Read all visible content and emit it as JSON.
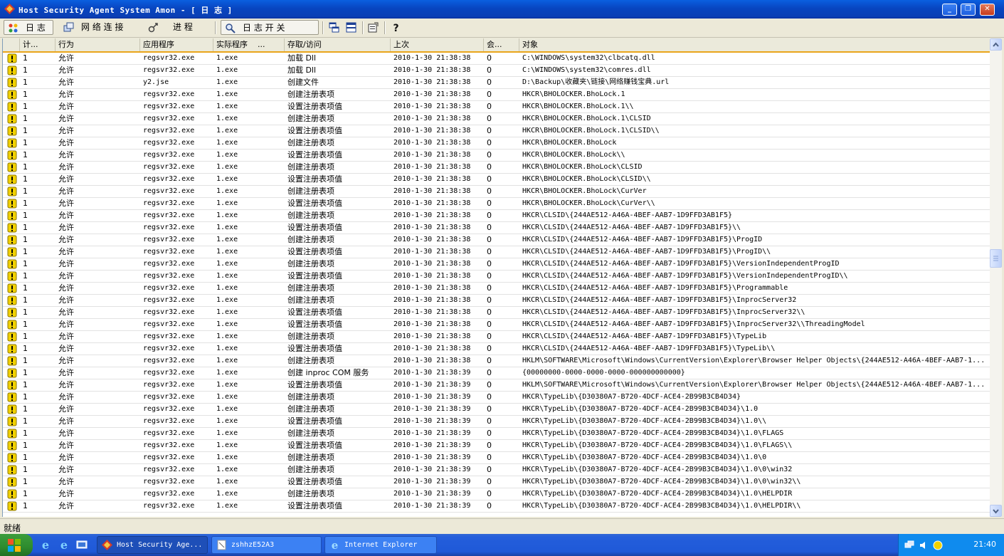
{
  "window": {
    "title": "Host Security Agent System Amon - [ 日 志 ]",
    "controls": {
      "minimize_icon": "minimize-icon",
      "maximize_icon": "restore-icon",
      "close_icon": "close-icon"
    }
  },
  "toolbar": {
    "log_label": "日 志",
    "network_label": "网 络 连 接",
    "process_label": "进 程",
    "log_switch_label": "日 志 开 关",
    "view1_icon": "tile-windows-icon",
    "view2_icon": "split-view-icon",
    "properties_icon": "properties-icon",
    "help_icon": "help-icon"
  },
  "columns": [
    "计...",
    "行为",
    "应用程序",
    "实际程序    ...",
    "存取/访问",
    "上次",
    "会...",
    "对象"
  ],
  "rows": [
    [
      "1",
      "允许",
      "regsvr32.exe",
      "1.exe",
      "加载 Dll",
      "2010-1-30 21:38:38",
      "0",
      "C:\\WINDOWS\\system32\\clbcatq.dll"
    ],
    [
      "1",
      "允许",
      "regsvr32.exe",
      "1.exe",
      "加载 Dll",
      "2010-1-30 21:38:38",
      "0",
      "C:\\WINDOWS\\system32\\comres.dll"
    ],
    [
      "1",
      "允许",
      "y2.jse",
      "1.exe",
      "创建文件",
      "2010-1-30 21:38:38",
      "0",
      "D:\\Backup\\收藏夹\\链接\\网络赚钱宝典.url"
    ],
    [
      "1",
      "允许",
      "regsvr32.exe",
      "1.exe",
      "创建注册表项",
      "2010-1-30 21:38:38",
      "0",
      "HKCR\\BHOLOCKER.BhoLock.1"
    ],
    [
      "1",
      "允许",
      "regsvr32.exe",
      "1.exe",
      "设置注册表项值",
      "2010-1-30 21:38:38",
      "0",
      "HKCR\\BHOLOCKER.BhoLock.1\\\\"
    ],
    [
      "1",
      "允许",
      "regsvr32.exe",
      "1.exe",
      "创建注册表项",
      "2010-1-30 21:38:38",
      "0",
      "HKCR\\BHOLOCKER.BhoLock.1\\CLSID"
    ],
    [
      "1",
      "允许",
      "regsvr32.exe",
      "1.exe",
      "设置注册表项值",
      "2010-1-30 21:38:38",
      "0",
      "HKCR\\BHOLOCKER.BhoLock.1\\CLSID\\\\"
    ],
    [
      "1",
      "允许",
      "regsvr32.exe",
      "1.exe",
      "创建注册表项",
      "2010-1-30 21:38:38",
      "0",
      "HKCR\\BHOLOCKER.BhoLock"
    ],
    [
      "1",
      "允许",
      "regsvr32.exe",
      "1.exe",
      "设置注册表项值",
      "2010-1-30 21:38:38",
      "0",
      "HKCR\\BHOLOCKER.BhoLock\\\\"
    ],
    [
      "1",
      "允许",
      "regsvr32.exe",
      "1.exe",
      "创建注册表项",
      "2010-1-30 21:38:38",
      "0",
      "HKCR\\BHOLOCKER.BhoLock\\CLSID"
    ],
    [
      "1",
      "允许",
      "regsvr32.exe",
      "1.exe",
      "设置注册表项值",
      "2010-1-30 21:38:38",
      "0",
      "HKCR\\BHOLOCKER.BhoLock\\CLSID\\\\"
    ],
    [
      "1",
      "允许",
      "regsvr32.exe",
      "1.exe",
      "创建注册表项",
      "2010-1-30 21:38:38",
      "0",
      "HKCR\\BHOLOCKER.BhoLock\\CurVer"
    ],
    [
      "1",
      "允许",
      "regsvr32.exe",
      "1.exe",
      "设置注册表项值",
      "2010-1-30 21:38:38",
      "0",
      "HKCR\\BHOLOCKER.BhoLock\\CurVer\\\\"
    ],
    [
      "1",
      "允许",
      "regsvr32.exe",
      "1.exe",
      "创建注册表项",
      "2010-1-30 21:38:38",
      "0",
      "HKCR\\CLSID\\{244AE512-A46A-4BEF-AAB7-1D9FFD3AB1F5}"
    ],
    [
      "1",
      "允许",
      "regsvr32.exe",
      "1.exe",
      "设置注册表项值",
      "2010-1-30 21:38:38",
      "0",
      "HKCR\\CLSID\\{244AE512-A46A-4BEF-AAB7-1D9FFD3AB1F5}\\\\"
    ],
    [
      "1",
      "允许",
      "regsvr32.exe",
      "1.exe",
      "创建注册表项",
      "2010-1-30 21:38:38",
      "0",
      "HKCR\\CLSID\\{244AE512-A46A-4BEF-AAB7-1D9FFD3AB1F5}\\ProgID"
    ],
    [
      "1",
      "允许",
      "regsvr32.exe",
      "1.exe",
      "设置注册表项值",
      "2010-1-30 21:38:38",
      "0",
      "HKCR\\CLSID\\{244AE512-A46A-4BEF-AAB7-1D9FFD3AB1F5}\\ProgID\\\\"
    ],
    [
      "1",
      "允许",
      "regsvr32.exe",
      "1.exe",
      "创建注册表项",
      "2010-1-30 21:38:38",
      "0",
      "HKCR\\CLSID\\{244AE512-A46A-4BEF-AAB7-1D9FFD3AB1F5}\\VersionIndependentProgID"
    ],
    [
      "1",
      "允许",
      "regsvr32.exe",
      "1.exe",
      "设置注册表项值",
      "2010-1-30 21:38:38",
      "0",
      "HKCR\\CLSID\\{244AE512-A46A-4BEF-AAB7-1D9FFD3AB1F5}\\VersionIndependentProgID\\\\"
    ],
    [
      "1",
      "允许",
      "regsvr32.exe",
      "1.exe",
      "创建注册表项",
      "2010-1-30 21:38:38",
      "0",
      "HKCR\\CLSID\\{244AE512-A46A-4BEF-AAB7-1D9FFD3AB1F5}\\Programmable"
    ],
    [
      "1",
      "允许",
      "regsvr32.exe",
      "1.exe",
      "创建注册表项",
      "2010-1-30 21:38:38",
      "0",
      "HKCR\\CLSID\\{244AE512-A46A-4BEF-AAB7-1D9FFD3AB1F5}\\InprocServer32"
    ],
    [
      "1",
      "允许",
      "regsvr32.exe",
      "1.exe",
      "设置注册表项值",
      "2010-1-30 21:38:38",
      "0",
      "HKCR\\CLSID\\{244AE512-A46A-4BEF-AAB7-1D9FFD3AB1F5}\\InprocServer32\\\\"
    ],
    [
      "1",
      "允许",
      "regsvr32.exe",
      "1.exe",
      "设置注册表项值",
      "2010-1-30 21:38:38",
      "0",
      "HKCR\\CLSID\\{244AE512-A46A-4BEF-AAB7-1D9FFD3AB1F5}\\InprocServer32\\\\ThreadingModel"
    ],
    [
      "1",
      "允许",
      "regsvr32.exe",
      "1.exe",
      "创建注册表项",
      "2010-1-30 21:38:38",
      "0",
      "HKCR\\CLSID\\{244AE512-A46A-4BEF-AAB7-1D9FFD3AB1F5}\\TypeLib"
    ],
    [
      "1",
      "允许",
      "regsvr32.exe",
      "1.exe",
      "设置注册表项值",
      "2010-1-30 21:38:38",
      "0",
      "HKCR\\CLSID\\{244AE512-A46A-4BEF-AAB7-1D9FFD3AB1F5}\\TypeLib\\\\"
    ],
    [
      "1",
      "允许",
      "regsvr32.exe",
      "1.exe",
      "创建注册表项",
      "2010-1-30 21:38:38",
      "0",
      "HKLM\\SOFTWARE\\Microsoft\\Windows\\CurrentVersion\\Explorer\\Browser Helper Objects\\{244AE512-A46A-4BEF-AAB7-1..."
    ],
    [
      "1",
      "允许",
      "regsvr32.exe",
      "1.exe",
      "创建 inproc COM 服务",
      "2010-1-30 21:38:39",
      "0",
      "{00000000-0000-0000-0000-000000000000}"
    ],
    [
      "1",
      "允许",
      "regsvr32.exe",
      "1.exe",
      "设置注册表项值",
      "2010-1-30 21:38:39",
      "0",
      "HKLM\\SOFTWARE\\Microsoft\\Windows\\CurrentVersion\\Explorer\\Browser Helper Objects\\{244AE512-A46A-4BEF-AAB7-1..."
    ],
    [
      "1",
      "允许",
      "regsvr32.exe",
      "1.exe",
      "创建注册表项",
      "2010-1-30 21:38:39",
      "0",
      "HKCR\\TypeLib\\{D30380A7-B720-4DCF-ACE4-2B99B3CB4D34}"
    ],
    [
      "1",
      "允许",
      "regsvr32.exe",
      "1.exe",
      "创建注册表项",
      "2010-1-30 21:38:39",
      "0",
      "HKCR\\TypeLib\\{D30380A7-B720-4DCF-ACE4-2B99B3CB4D34}\\1.0"
    ],
    [
      "1",
      "允许",
      "regsvr32.exe",
      "1.exe",
      "设置注册表项值",
      "2010-1-30 21:38:39",
      "0",
      "HKCR\\TypeLib\\{D30380A7-B720-4DCF-ACE4-2B99B3CB4D34}\\1.0\\\\"
    ],
    [
      "1",
      "允许",
      "regsvr32.exe",
      "1.exe",
      "创建注册表项",
      "2010-1-30 21:38:39",
      "0",
      "HKCR\\TypeLib\\{D30380A7-B720-4DCF-ACE4-2B99B3CB4D34}\\1.0\\FLAGS"
    ],
    [
      "1",
      "允许",
      "regsvr32.exe",
      "1.exe",
      "设置注册表项值",
      "2010-1-30 21:38:39",
      "0",
      "HKCR\\TypeLib\\{D30380A7-B720-4DCF-ACE4-2B99B3CB4D34}\\1.0\\FLAGS\\\\"
    ],
    [
      "1",
      "允许",
      "regsvr32.exe",
      "1.exe",
      "创建注册表项",
      "2010-1-30 21:38:39",
      "0",
      "HKCR\\TypeLib\\{D30380A7-B720-4DCF-ACE4-2B99B3CB4D34}\\1.0\\0"
    ],
    [
      "1",
      "允许",
      "regsvr32.exe",
      "1.exe",
      "创建注册表项",
      "2010-1-30 21:38:39",
      "0",
      "HKCR\\TypeLib\\{D30380A7-B720-4DCF-ACE4-2B99B3CB4D34}\\1.0\\0\\win32"
    ],
    [
      "1",
      "允许",
      "regsvr32.exe",
      "1.exe",
      "设置注册表项值",
      "2010-1-30 21:38:39",
      "0",
      "HKCR\\TypeLib\\{D30380A7-B720-4DCF-ACE4-2B99B3CB4D34}\\1.0\\0\\win32\\\\"
    ],
    [
      "1",
      "允许",
      "regsvr32.exe",
      "1.exe",
      "创建注册表项",
      "2010-1-30 21:38:39",
      "0",
      "HKCR\\TypeLib\\{D30380A7-B720-4DCF-ACE4-2B99B3CB4D34}\\1.0\\HELPDIR"
    ],
    [
      "1",
      "允许",
      "regsvr32.exe",
      "1.exe",
      "设置注册表项值",
      "2010-1-30 21:38:39",
      "0",
      "HKCR\\TypeLib\\{D30380A7-B720-4DCF-ACE4-2B99B3CB4D34}\\1.0\\HELPDIR\\\\"
    ]
  ],
  "row_icon": "warning-icon",
  "status": {
    "text": "就绪"
  },
  "taskbar": {
    "start_icon": "windows-logo-icon",
    "tasks": [
      {
        "label": "Host Security Age...",
        "icon": "amon-app-icon"
      },
      {
        "label": "zshhzE52A3",
        "icon": "document-icon"
      },
      {
        "label": "Internet Explorer",
        "icon": "ie-icon"
      }
    ],
    "clock": "21:40"
  },
  "colors": {
    "titlebar": "#0a46c8",
    "header_underline": "#e9a51b",
    "warning": "#f2d200"
  }
}
